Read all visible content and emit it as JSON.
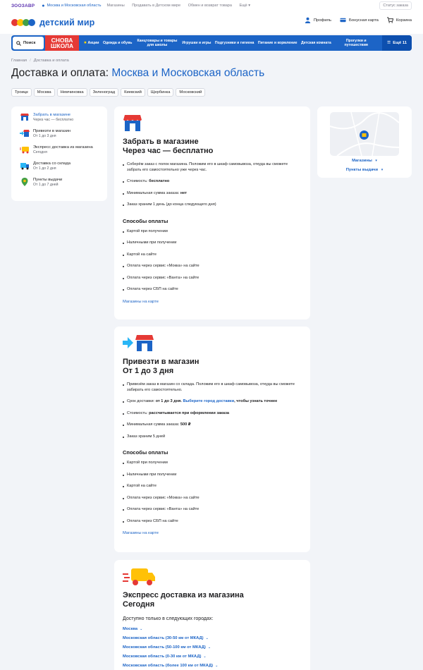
{
  "topbar": {
    "brand": "ЗООЗАВР",
    "location": "Москва и Московская область",
    "links": [
      "Магазины",
      "Продавать в Детском мире",
      "Обмен и возврат товара",
      "Ещё"
    ],
    "status_order": "Статус заказа"
  },
  "header": {
    "logo": "детский мир",
    "profile": "Профиль",
    "bonus": "Бонусная карта",
    "cart": "Корзина"
  },
  "nav": {
    "search": "Поиск",
    "snova_line1": "СНОВА",
    "snova_line2": "ШКОЛА",
    "items": [
      "Акции",
      "Одежда и обувь",
      "Канцтовары и товары для школы",
      "Игрушки и игры",
      "Подгузники и гигиена",
      "Питание и кормление",
      "Детская комната",
      "Прогулки и путешествия"
    ],
    "more": "Ещё 11"
  },
  "breadcrumb": {
    "home": "Главная",
    "current": "Доставка и оплата"
  },
  "title": {
    "prefix": "Доставка и оплата:",
    "city": "Москва и Московская область"
  },
  "chips": [
    "Троицк",
    "Москва",
    "Немчиновка",
    "Зеленоград",
    "Киевский",
    "Щербинка",
    "Московский"
  ],
  "sidebar": [
    {
      "label": "Забрать в магазине",
      "sub": "Через час — бесплатно"
    },
    {
      "label": "Привезти в магазин",
      "sub": "От 1 до 3 дня"
    },
    {
      "label": "Экспресс доставка из магазина",
      "sub": "Сегодня"
    },
    {
      "label": "Доставка со склада",
      "sub": "От 1 до 2 дня"
    },
    {
      "label": "Пункты выдачи",
      "sub": "От 1 до 7 дней"
    }
  ],
  "map": {
    "stores_link": "Магазины",
    "points_link": "Пункты выдачи"
  },
  "card1": {
    "title1": "Забрать в магазине",
    "title2": "Через час — бесплатно",
    "b1": "Соберём заказ с полок магазина. Положим его в шкаф самовывоза, откуда вы сможете забрать его самостоятельно уже через час.",
    "b2_label": "Стоимость:",
    "b2_value": "бесплатно",
    "b3_label": "Минимальная сумма заказа:",
    "b3_value": "нет",
    "b4": "Заказ храним 1 день (до конца следующего дня)",
    "payments_title": "Способы оплаты",
    "payments": [
      "Картой при получении",
      "Наличными при получении",
      "Картой на сайте",
      "Оплата через сервис «Мокка» на сайте",
      "Оплата через сервис «Ванта» на сайте",
      "Оплата через СБП на сайте"
    ],
    "link": "Магазины на карте"
  },
  "card2": {
    "title1": "Привезти в магазин",
    "title2": "От 1 до 3 дня",
    "b1": "Привезём заказ в магазин со склада. Положим его в шкаф самовывоза, откуда вы сможете забирать его самостоятельно.",
    "b2_label": "Срок доставки:",
    "b2_value": "от 1 до 3 дня.",
    "b2_link": "Выберите город доставки",
    "b2_tail": ", чтобы узнать точнее",
    "b3_label": "Стоимость:",
    "b3_value": "рассчитывается при оформлении заказа",
    "b4_label": "Минимальная сумма заказа:",
    "b4_value": "500 ₽",
    "b5": "Заказ храним 5 дней",
    "payments_title": "Способы оплаты",
    "payments": [
      "Картой при получении",
      "Наличными при получении",
      "Картой на сайте",
      "Оплата через сервис «Мокка» на сайте",
      "Оплата через сервис «Ванта» на сайте",
      "Оплата через СБП на сайте"
    ],
    "link": "Магазины на карте"
  },
  "card3": {
    "title1": "Экспресс доставка из магазина",
    "title2": "Сегодня",
    "available": "Доступно только в следующих городах:",
    "cities": [
      "Москва",
      "Московская область (30-50 км от МКАД)",
      "Московская область (50-100 км от МКАД)",
      "Московская область (0-30 км от МКАД)",
      "Московская область (более 100 км от МКАД)"
    ]
  },
  "colors": {
    "brand_blue": "#1c64c6",
    "red": "#e53935",
    "yellow": "#ffc107"
  }
}
